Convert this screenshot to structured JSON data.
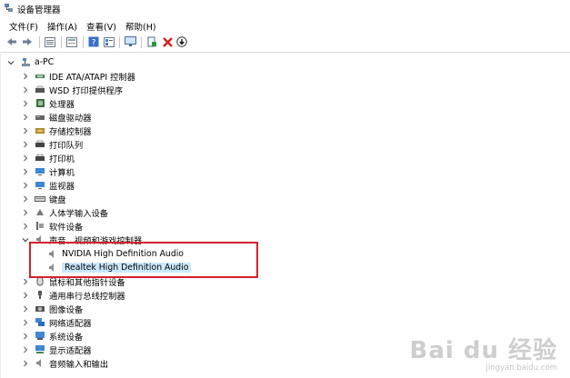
{
  "window": {
    "title": "设备管理器"
  },
  "menu": [
    "文件(F)",
    "操作(A)",
    "查看(V)",
    "帮助(H)"
  ],
  "toolbar": [
    "back-icon",
    "forward-icon",
    "properties-view-icon",
    "help-page-icon",
    "help-icon",
    "device-list-icon",
    "monitor-icon",
    "add-driver-icon",
    "uninstall-icon",
    "download-icon"
  ],
  "tree": {
    "root": "a-PC",
    "items": [
      {
        "label": "IDE ATA/ATAPI 控制器",
        "icon": "ide-controller-icon"
      },
      {
        "label": "WSD 打印提供程序",
        "icon": "printer-provider-icon"
      },
      {
        "label": "处理器",
        "icon": "processor-icon"
      },
      {
        "label": "磁盘驱动器",
        "icon": "disk-drive-icon"
      },
      {
        "label": "存储控制器",
        "icon": "storage-controller-icon"
      },
      {
        "label": "打印队列",
        "icon": "print-queue-icon"
      },
      {
        "label": "打印机",
        "icon": "printer-icon"
      },
      {
        "label": "计算机",
        "icon": "computer-icon"
      },
      {
        "label": "监视器",
        "icon": "monitor-icon"
      },
      {
        "label": "键盘",
        "icon": "keyboard-icon"
      },
      {
        "label": "人体学输入设备",
        "icon": "hid-icon"
      },
      {
        "label": "软件设备",
        "icon": "software-device-icon"
      },
      {
        "label": "声音、视频和游戏控制器",
        "icon": "sound-icon",
        "expanded": true,
        "children": [
          {
            "label": "NVIDIA High Definition Audio",
            "icon": "speaker-icon"
          },
          {
            "label": "Realtek High Definition Audio",
            "icon": "speaker-icon",
            "selected": true
          }
        ]
      },
      {
        "label": "鼠标和其他指针设备",
        "icon": "mouse-icon"
      },
      {
        "label": "通用串行总线控制器",
        "icon": "usb-icon"
      },
      {
        "label": "图像设备",
        "icon": "camera-icon"
      },
      {
        "label": "网络适配器",
        "icon": "network-icon"
      },
      {
        "label": "系统设备",
        "icon": "system-device-icon"
      },
      {
        "label": "显示适配器",
        "icon": "display-adapter-icon"
      },
      {
        "label": "音频输入和输出",
        "icon": "audio-io-icon"
      }
    ]
  },
  "watermark": {
    "brand": "Bai du 经验",
    "url": "jingyan.baidu.com"
  },
  "colors": {
    "highlight": "#cce8ff",
    "annotation": "#d8202a"
  }
}
